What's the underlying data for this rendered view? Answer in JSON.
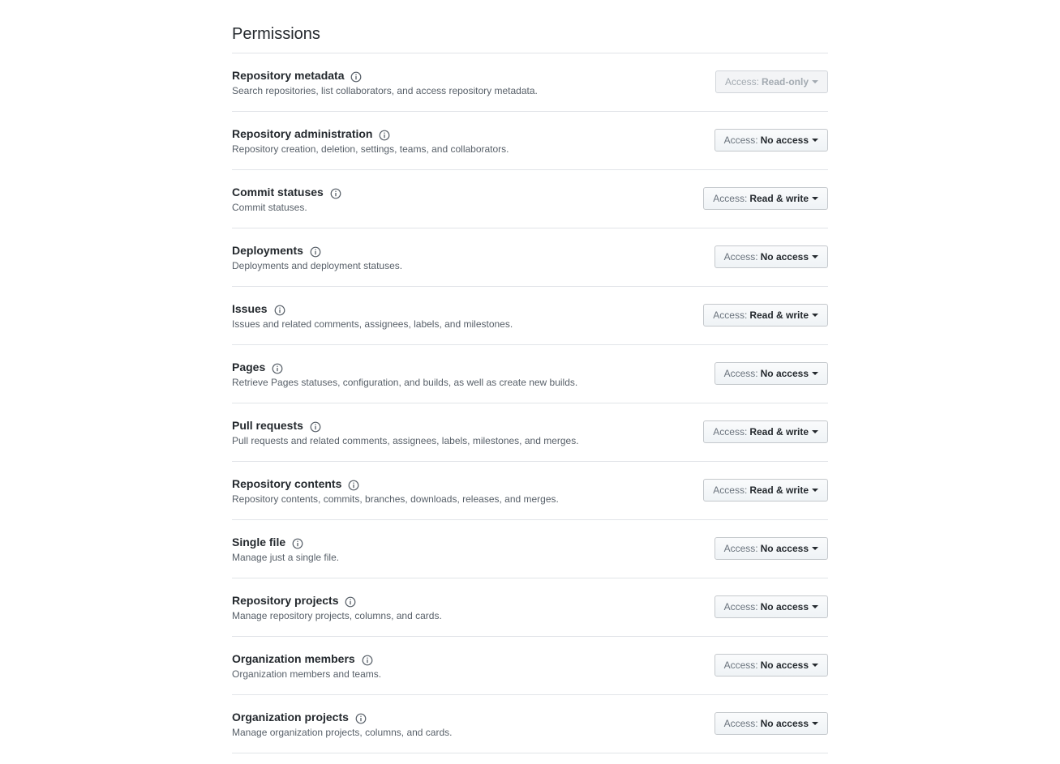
{
  "page": {
    "title": "Permissions",
    "access_prefix": "Access:"
  },
  "permissions": [
    {
      "title": "Repository metadata",
      "description": "Search repositories, list collaborators, and access repository metadata.",
      "access": "Read-only",
      "disabled": true
    },
    {
      "title": "Repository administration",
      "description": "Repository creation, deletion, settings, teams, and collaborators.",
      "access": "No access",
      "disabled": false
    },
    {
      "title": "Commit statuses",
      "description": "Commit statuses.",
      "access": "Read & write",
      "disabled": false
    },
    {
      "title": "Deployments",
      "description": "Deployments and deployment statuses.",
      "access": "No access",
      "disabled": false
    },
    {
      "title": "Issues",
      "description": "Issues and related comments, assignees, labels, and milestones.",
      "access": "Read & write",
      "disabled": false
    },
    {
      "title": "Pages",
      "description": "Retrieve Pages statuses, configuration, and builds, as well as create new builds.",
      "access": "No access",
      "disabled": false
    },
    {
      "title": "Pull requests",
      "description": "Pull requests and related comments, assignees, labels, milestones, and merges.",
      "access": "Read & write",
      "disabled": false
    },
    {
      "title": "Repository contents",
      "description": "Repository contents, commits, branches, downloads, releases, and merges.",
      "access": "Read & write",
      "disabled": false
    },
    {
      "title": "Single file",
      "description": "Manage just a single file.",
      "access": "No access",
      "disabled": false
    },
    {
      "title": "Repository projects",
      "description": "Manage repository projects, columns, and cards.",
      "access": "No access",
      "disabled": false
    },
    {
      "title": "Organization members",
      "description": "Organization members and teams.",
      "access": "No access",
      "disabled": false
    },
    {
      "title": "Organization projects",
      "description": "Manage organization projects, columns, and cards.",
      "access": "No access",
      "disabled": false
    }
  ],
  "icons": {
    "info": "info-icon",
    "caret": "caret-down-icon"
  },
  "colors": {
    "title_text": "#24292e",
    "description_text": "#586069",
    "divider": "#e1e4e8",
    "disabled_text": "#a3aab1"
  }
}
